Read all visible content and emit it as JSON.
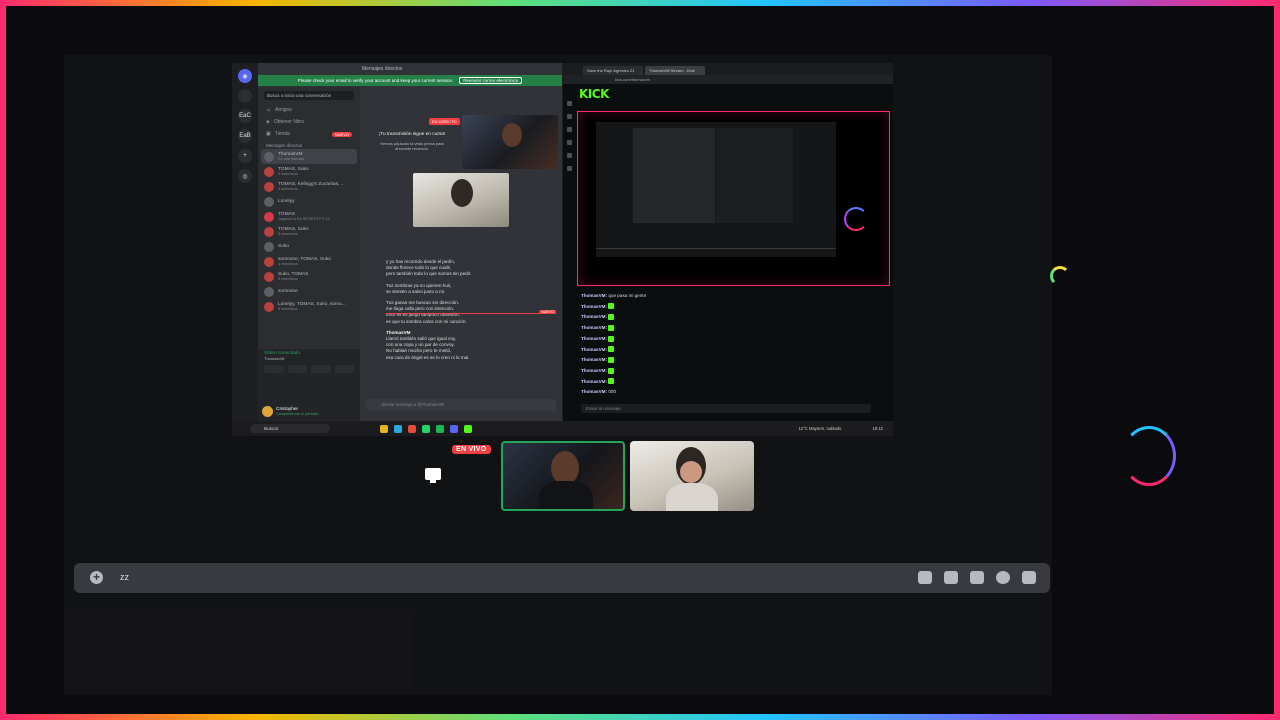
{
  "discord": {
    "window_title": "Mensajes directos",
    "verify_banner": "Please check your email to verify your account and keep your current session.",
    "verify_button": "Reenviar correo electrónico",
    "search_placeholder": "Busca o inicia una conversación",
    "nav": [
      {
        "label": "Amigos"
      },
      {
        "label": "Obtener Nitro"
      },
      {
        "label": "Tienda",
        "badge": "NUEVO"
      }
    ],
    "dm_section": "Mensajes directos",
    "dms": [
      {
        "name": "ThomasVM",
        "status": "En una llamada"
      },
      {
        "name": "TOMAS, Suko",
        "status": "3 miembros"
      },
      {
        "name": "TOMAS, Kellogg's Zucaritas, ...",
        "status": "4 miembros"
      },
      {
        "name": "Lonelyy",
        "status": ""
      },
      {
        "name": "TOMAS",
        "status": "Jugando a EA SPORTS FC 24"
      },
      {
        "name": "TOMAS, Suko",
        "status": "3 miembros"
      },
      {
        "name": "Suko",
        "status": ""
      },
      {
        "name": "somoone, TOMAS, Suko",
        "status": "4 miembros"
      },
      {
        "name": "Suko, TOMAS",
        "status": "3 miembros"
      },
      {
        "name": "somoone",
        "status": ""
      },
      {
        "name": "Lonelyy, TOMAS, Suko, somo...",
        "status": "5 miembros"
      }
    ],
    "voice_status": "Vídeo conectado",
    "voice_channel": "ThomasVM",
    "user_name": "Cristopher",
    "user_status": "Compartiendo tu pantalla",
    "live_tag": "EN DIRECTO",
    "live_title": "¡Tu transmisión sigue en curso!",
    "live_subtitle": "Hemos pausado la vista previa para ahorrarte recursos.",
    "messages_a": [
      "y yo has recorrido desde el jardín,",
      "donde florece todo lo que cuidé,",
      "pero también todo lo que somos sin pedir."
    ],
    "messages_b": [
      "Tus sombras ya no quieren huir,",
      "se sienten a salvo junto a mí."
    ],
    "new_label": "NUEVO",
    "messages_c": [
      "Tus ganas me buscan sin dirección,",
      "me llega calla pero con intención.",
      "Esto es es juego tampoco obsesión,",
      "es que tu sombra calza con mi canción."
    ],
    "author": "ThomasVM",
    "messages_d": [
      "Llamó también salió que igual voy,",
      "con una copa y un par de convoy.",
      "No hablaé mucho pero te metió,",
      "esa cara de ángel es se lo creo ni lo mal."
    ],
    "input_placeholder": "Enviar mensaje a @ThomasVM"
  },
  "kick": {
    "tabs": [
      "Save the Rap! Agresivo 21",
      "ThomasVM Stream - Kick"
    ],
    "url": "kick.com/thomasvm",
    "logo": "KICK",
    "chat": [
      {
        "user": "ThomasVM:",
        "text": "que pasa mi gente"
      },
      {
        "user": "ThomasVM:",
        "text": ""
      },
      {
        "user": "ThomasVM:",
        "text": ""
      },
      {
        "user": "ThomasVM:",
        "text": ""
      },
      {
        "user": "ThomasVM:",
        "text": ""
      },
      {
        "user": "ThomasVM:",
        "text": ""
      },
      {
        "user": "ThomasVM:",
        "text": ""
      },
      {
        "user": "ThomasVM:",
        "text": ""
      },
      {
        "user": "ThomasVM:",
        "text": ""
      },
      {
        "user": "ThomasVM:",
        "text": "000"
      }
    ],
    "input_placeholder": "Enviar un mensaje"
  },
  "taskbar": {
    "search": "Buscar",
    "weather": "12°C Mayorm. nublado",
    "time": "19:12"
  },
  "stage": {
    "live_badge": "EN VIVO"
  },
  "message_bar": {
    "text": "zz"
  },
  "colors": {
    "discord_green": "#23a55a",
    "kick_green": "#53fc18",
    "live_red": "#f23f43",
    "blurple": "#5865f2"
  }
}
